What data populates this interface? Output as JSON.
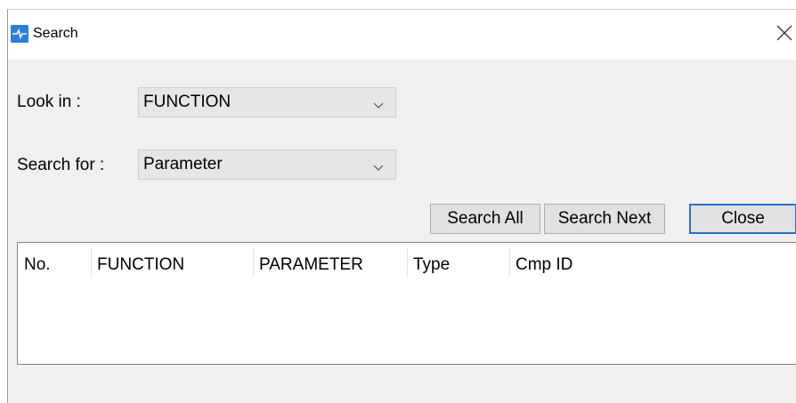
{
  "window": {
    "title": "Search",
    "app_icon": "app-logo-icon",
    "close_icon": "close-icon"
  },
  "form": {
    "look_in_label": "Look in :",
    "look_in_value": "FUNCTION",
    "search_for_label": "Search for :",
    "search_for_value": "Parameter"
  },
  "buttons": {
    "search_all": "Search All",
    "search_next": "Search Next",
    "close": "Close"
  },
  "results": {
    "columns": [
      "No.",
      "FUNCTION",
      "PARAMETER",
      "Type",
      "Cmp ID"
    ],
    "rows": []
  },
  "colors": {
    "accent": "#2673c9",
    "window_bg": "#f0f0f0",
    "title_bg": "#ffffff"
  }
}
